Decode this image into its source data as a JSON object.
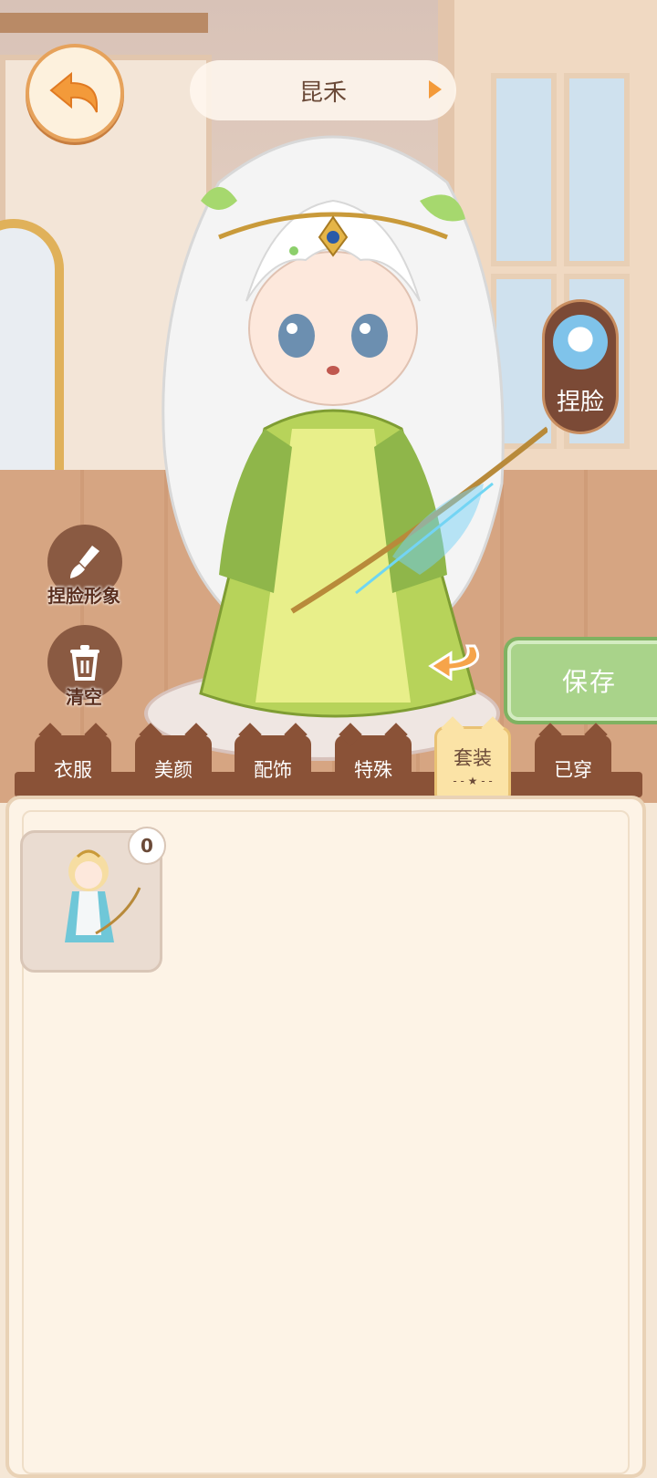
{
  "header": {
    "character_name": "昆禾"
  },
  "buttons": {
    "face_label": "捏脸",
    "face_image_label": "捏脸形象",
    "clear_label": "清空",
    "save_label": "保存"
  },
  "tabs": [
    {
      "label": "衣服"
    },
    {
      "label": "美颜"
    },
    {
      "label": "配饰"
    },
    {
      "label": "特殊"
    },
    {
      "label": "套装",
      "active": true
    },
    {
      "label": "已穿"
    }
  ],
  "items": [
    {
      "count": "0"
    }
  ],
  "icons": [
    "back-arrow-icon",
    "brush-icon",
    "trash-icon",
    "rotate-arrow-icon",
    "star-icon"
  ],
  "colors": {
    "accent": "#f39a3a",
    "tab_bg": "#8a5237",
    "active_tab": "#fbe3a6",
    "save": "#a9d38a"
  }
}
